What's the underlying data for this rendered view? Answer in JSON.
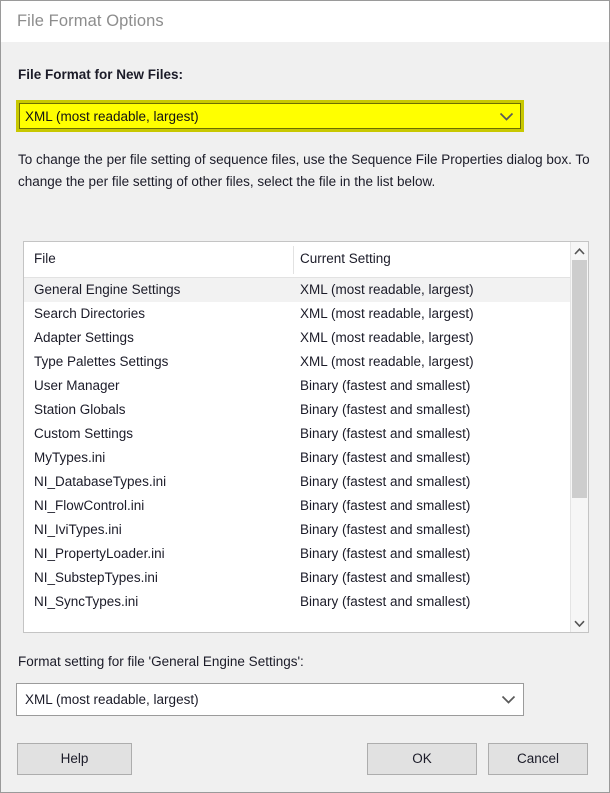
{
  "window": {
    "title": "File Format Options"
  },
  "form": {
    "new_files_label": "File Format for New Files:",
    "new_files_value": "XML (most readable, largest)",
    "description": "To change the per file setting of sequence files, use the Sequence File Properties dialog box. To change the per file setting of other files, select the file in the list below.",
    "file_setting_label": "Format setting for file 'General Engine Settings':",
    "file_setting_value": "XML (most readable, largest)"
  },
  "list": {
    "columns": [
      "File",
      "Current Setting"
    ],
    "rows": [
      {
        "file": "General Engine Settings",
        "setting": "XML (most readable, largest)",
        "selected": true
      },
      {
        "file": "Search Directories",
        "setting": "XML (most readable, largest)",
        "selected": false
      },
      {
        "file": "Adapter Settings",
        "setting": "XML (most readable, largest)",
        "selected": false
      },
      {
        "file": "Type Palettes Settings",
        "setting": "XML (most readable, largest)",
        "selected": false
      },
      {
        "file": "User Manager",
        "setting": "Binary (fastest and smallest)",
        "selected": false
      },
      {
        "file": "Station Globals",
        "setting": "Binary (fastest and smallest)",
        "selected": false
      },
      {
        "file": "Custom Settings",
        "setting": "Binary (fastest and smallest)",
        "selected": false
      },
      {
        "file": "MyTypes.ini",
        "setting": "Binary (fastest and smallest)",
        "selected": false
      },
      {
        "file": "NI_DatabaseTypes.ini",
        "setting": "Binary (fastest and smallest)",
        "selected": false
      },
      {
        "file": "NI_FlowControl.ini",
        "setting": "Binary (fastest and smallest)",
        "selected": false
      },
      {
        "file": "NI_IviTypes.ini",
        "setting": "Binary (fastest and smallest)",
        "selected": false
      },
      {
        "file": "NI_PropertyLoader.ini",
        "setting": "Binary (fastest and smallest)",
        "selected": false
      },
      {
        "file": "NI_SubstepTypes.ini",
        "setting": "Binary (fastest and smallest)",
        "selected": false
      },
      {
        "file": "NI_SyncTypes.ini",
        "setting": "Binary (fastest and smallest)",
        "selected": false
      }
    ]
  },
  "buttons": {
    "help": "Help",
    "ok": "OK",
    "cancel": "Cancel"
  },
  "icons": {
    "combo_chevron": "chevron-down-icon",
    "scroll_up": "scroll-up-arrow-icon",
    "scroll_down": "scroll-down-arrow-icon"
  },
  "colors": {
    "highlight": "#ffff00",
    "highlight_border": "#6d6d00",
    "dialog_bg": "#f0f0f0",
    "text": "#1b1b28",
    "title_text": "#8d8d8d"
  }
}
